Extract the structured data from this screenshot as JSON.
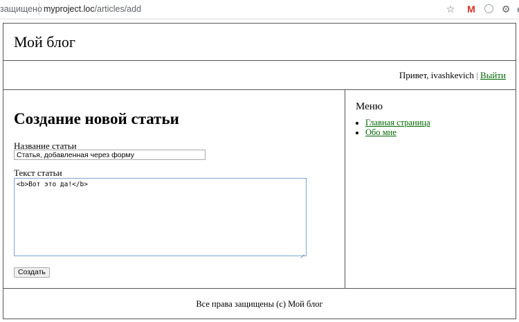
{
  "browser": {
    "secure_label": "защищено",
    "url_host": "myproject.loc",
    "url_path": "/articles/add",
    "gmail_icon_text": "M",
    "more_icon_text": "e"
  },
  "header": {
    "site_title": "Мой блог"
  },
  "userbar": {
    "greeting": "Привет, ivashkevich",
    "divider": "|",
    "logout_label": "Выйти"
  },
  "form": {
    "heading": "Создание новой статьи",
    "title_label": "Название статьи",
    "title_value": "Статья, добавленная через форму",
    "text_label": "Текст статьи",
    "text_value": "<b>Вот это да!</b>",
    "submit_label": "Создать"
  },
  "sidebar": {
    "menu_title": "Меню",
    "items": [
      {
        "label": "Главная страница"
      },
      {
        "label": "Обо мне"
      }
    ]
  },
  "footer": {
    "text": "Все права защищены (c) Мой блог"
  },
  "colors": {
    "link": "#006600",
    "border": "#555555",
    "textarea_focus": "#7aa4d8"
  }
}
